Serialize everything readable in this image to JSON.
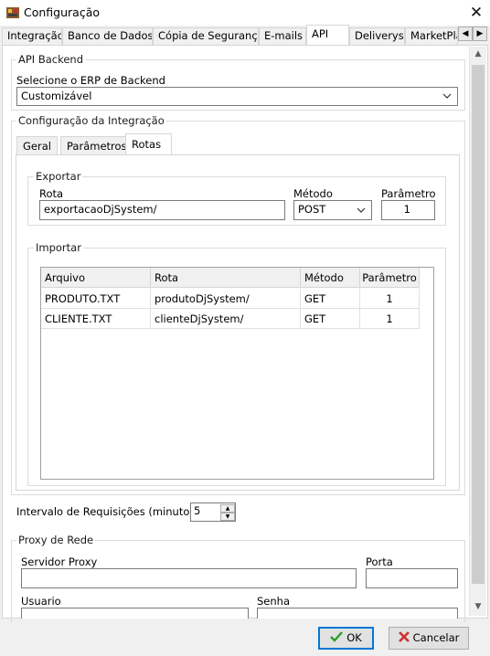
{
  "window": {
    "title": "Configuração",
    "close_glyph": "✕"
  },
  "tabs": [
    "Integração",
    "Banco de Dados",
    "Cópia de Segurança",
    "E-mails",
    "API",
    "Deliverys",
    "MarketPla"
  ],
  "tab_scroll": {
    "left": "◀",
    "right": "▶"
  },
  "api_backend": {
    "group_title": "API Backend",
    "erp_label": "Selecione o ERP de Backend",
    "erp_value": "Customizável"
  },
  "integracao": {
    "group_title": "Configuração da Integração",
    "inner_tabs": [
      "Geral",
      "Parâmetros",
      "Rotas"
    ],
    "exportar": {
      "group_title": "Exportar",
      "rota_label": "Rota",
      "rota_value": "exportacaoDjSystem/",
      "metodo_label": "Método",
      "metodo_value": "POST",
      "parametro_label": "Parâmetro",
      "parametro_value": "1"
    },
    "importar": {
      "group_title": "Importar",
      "columns": [
        "Arquivo",
        "Rota",
        "Método",
        "Parâmetro"
      ],
      "rows": [
        [
          "PRODUTO.TXT",
          "produtoDjSystem/",
          "GET",
          "1"
        ],
        [
          "CLIENTE.TXT",
          "clienteDjSystem/",
          "GET",
          "1"
        ]
      ]
    }
  },
  "intervalo": {
    "label": "Intervalo de Requisições (minutos):",
    "value": "5"
  },
  "proxy": {
    "group_title": "Proxy de Rede",
    "servidor_label": "Servidor Proxy",
    "porta_label": "Porta",
    "usuario_label": "Usuario",
    "senha_label": "Senha"
  },
  "footer": {
    "ok_label": "OK",
    "cancel_label": "Cancelar"
  },
  "colors": {
    "accent": "#0078d7",
    "ok_check": "#2e9e2e",
    "cancel_x": "#d03030"
  }
}
